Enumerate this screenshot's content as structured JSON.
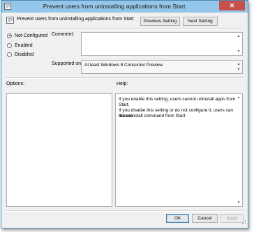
{
  "window": {
    "title": "Prevent users from uninstalling applications from Start",
    "close_label": "✕"
  },
  "header": {
    "policy_name": "Prevent users from uninstalling applications from Start",
    "previous_label": "Previous Setting",
    "next_label": "Next Setting"
  },
  "state": {
    "options": [
      {
        "label": "Not Configured",
        "checked": true
      },
      {
        "label": "Enabled",
        "checked": false
      },
      {
        "label": "Disabled",
        "checked": false
      }
    ]
  },
  "comment": {
    "label": "Comment:",
    "value": ""
  },
  "supported": {
    "label": "Supported on:",
    "value": "At least Windows 8 Consumer Preview"
  },
  "options_panel": {
    "label": "Options:"
  },
  "help_panel": {
    "label": "Help:",
    "paragraph1": "If you enable this setting, users cannot uninstall apps from Start.",
    "paragraph2_line1": "If you disable this setting or do not configure it, users can access",
    "paragraph2_line2": "the uninstall command from Start"
  },
  "footer": {
    "ok_label": "OK",
    "cancel_label": "Cancel",
    "apply_label": "Apply"
  },
  "colors": {
    "titlebar": "#93c6e8",
    "close": "#c7504b"
  }
}
